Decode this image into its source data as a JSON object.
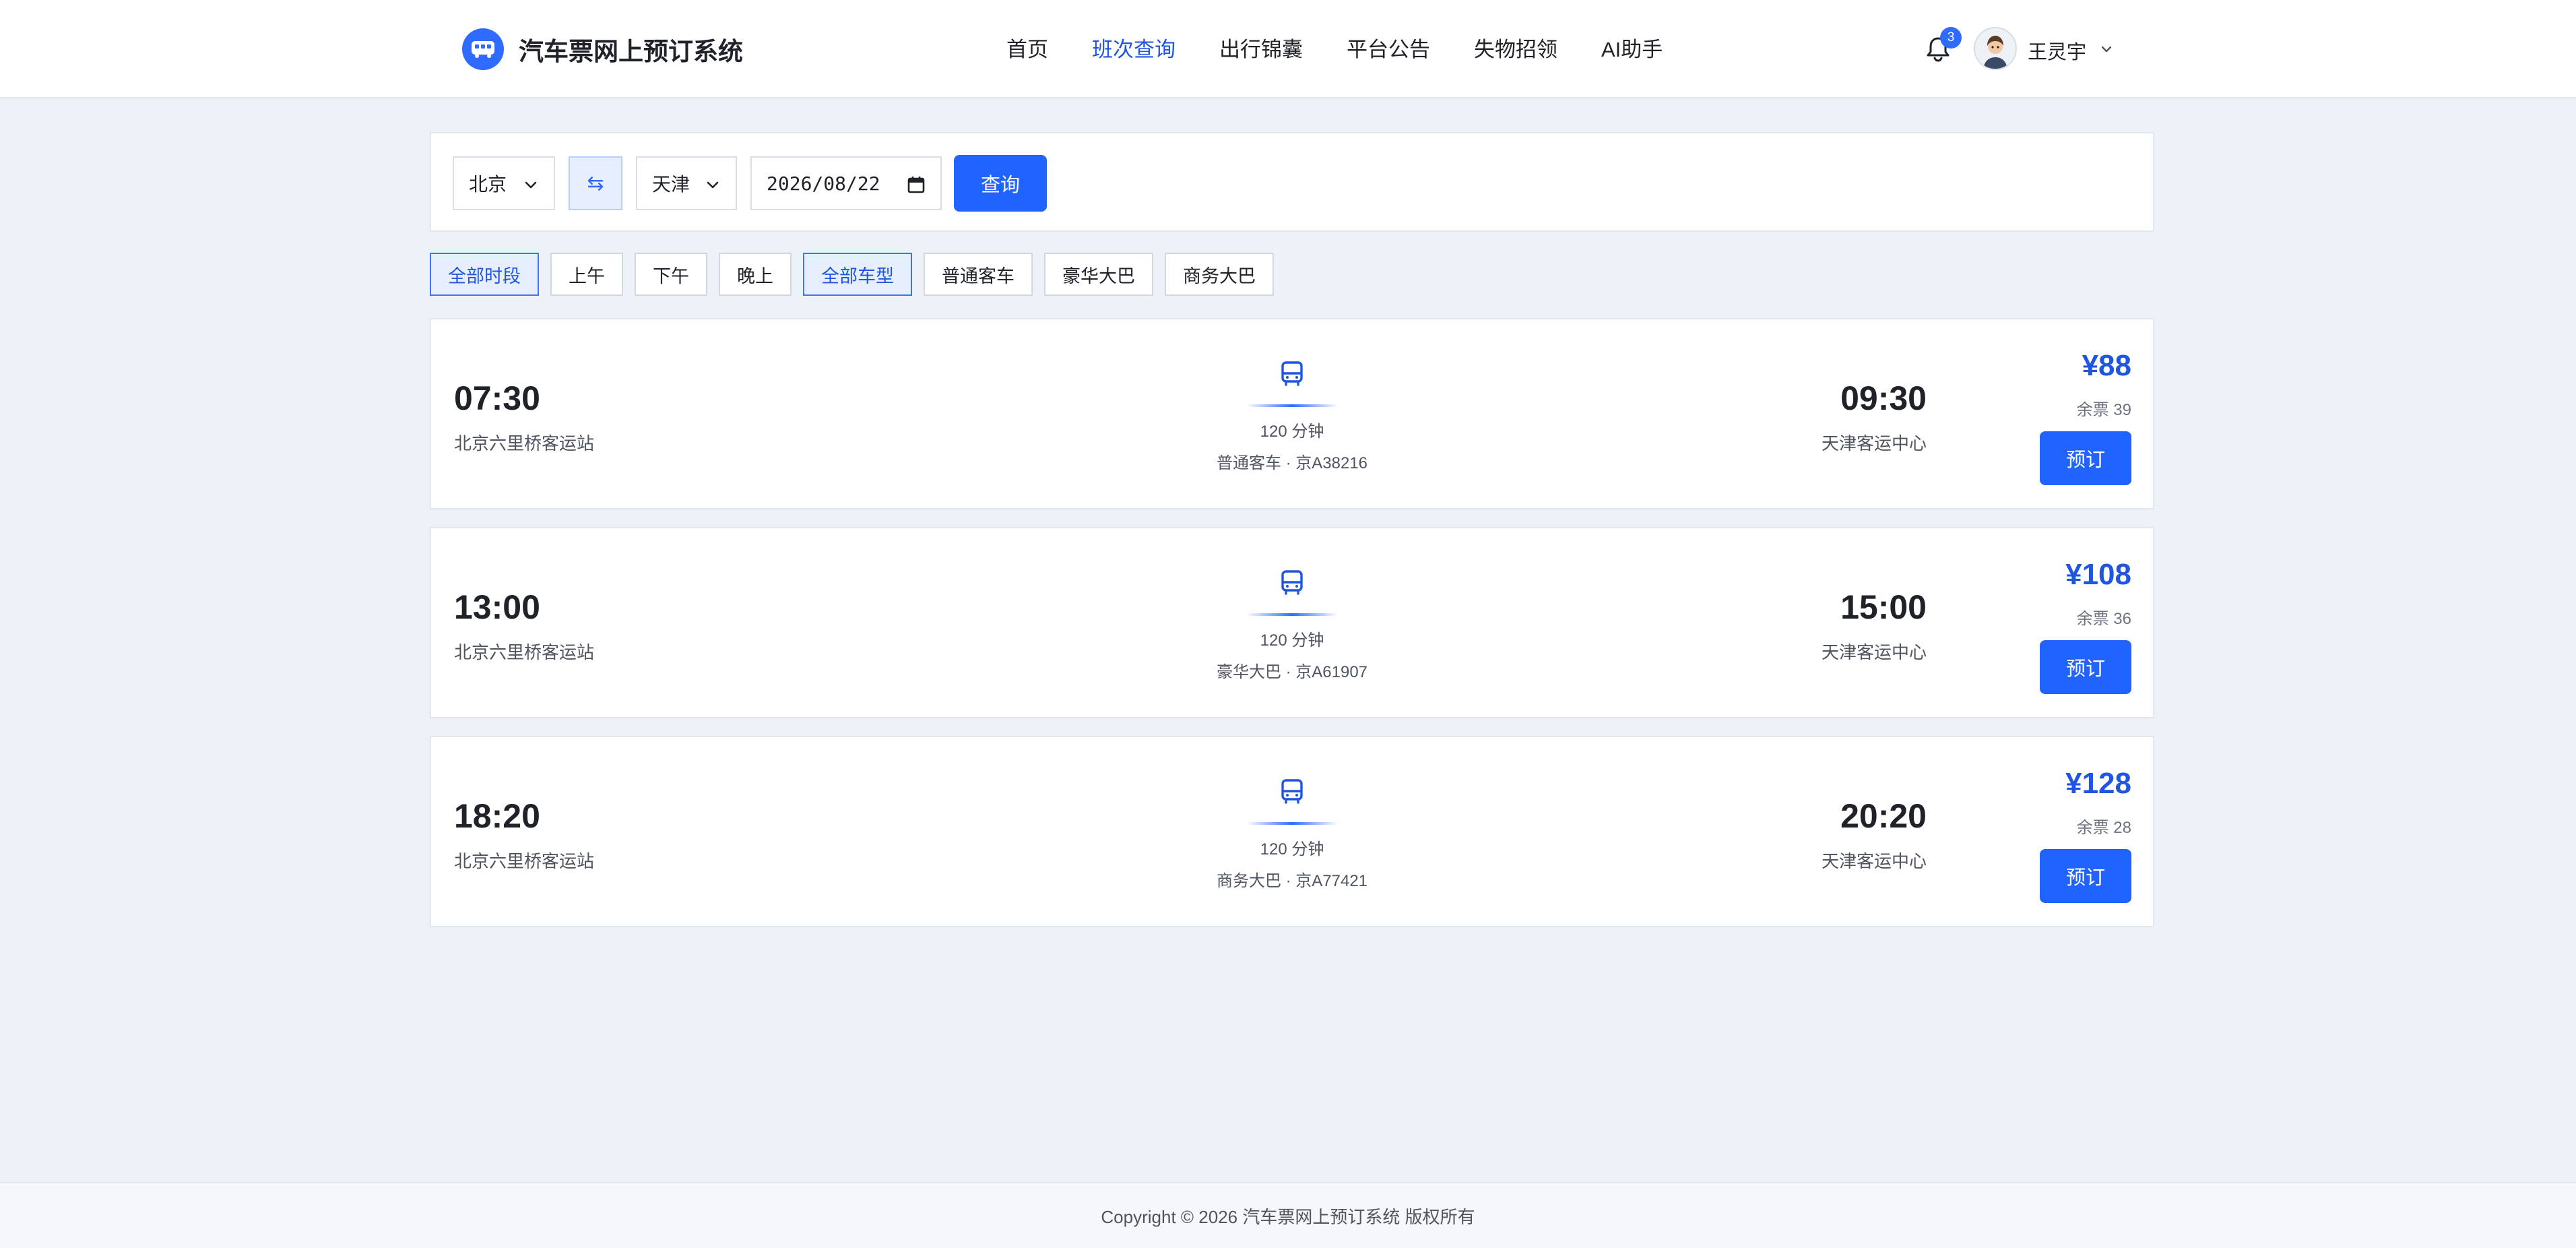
{
  "header": {
    "app_title": "汽车票网上预订系统",
    "nav": [
      "首页",
      "班次查询",
      "出行锦囊",
      "平台公告",
      "失物招领",
      "AI助手"
    ],
    "active_nav": "班次查询",
    "notification_count": "3",
    "user_name": "王灵宇"
  },
  "search": {
    "from": "北京",
    "swap_symbol": "⇆",
    "to": "天津",
    "date": "2026/08/22",
    "query_label": "查询"
  },
  "filters": {
    "time": [
      "全部时段",
      "上午",
      "下午",
      "晚上"
    ],
    "bus_type": [
      "全部车型",
      "普通客车",
      "豪华大巴",
      "商务大巴"
    ],
    "active": [
      "全部时段",
      "全部车型"
    ]
  },
  "trips": [
    {
      "dep_time": "07:30",
      "dep_station": "北京六里桥客运站",
      "duration": "120 分钟",
      "bus_info": "普通客车 · 京A38216",
      "arr_time": "09:30",
      "arr_station": "天津客运中心",
      "price": "¥88",
      "remaining": "余票 39",
      "book_label": "预订"
    },
    {
      "dep_time": "13:00",
      "dep_station": "北京六里桥客运站",
      "duration": "120 分钟",
      "bus_info": "豪华大巴 · 京A61907",
      "arr_time": "15:00",
      "arr_station": "天津客运中心",
      "price": "¥108",
      "remaining": "余票 36",
      "book_label": "预订"
    },
    {
      "dep_time": "18:20",
      "dep_station": "北京六里桥客运站",
      "duration": "120 分钟",
      "bus_info": "商务大巴 · 京A77421",
      "arr_time": "20:20",
      "arr_station": "天津客运中心",
      "price": "¥128",
      "remaining": "余票 28",
      "book_label": "预订"
    }
  ],
  "footer": {
    "copyright": "Copyright © 2026 汽车票网上预订系统 版权所有"
  },
  "icons": {
    "logo": "bus-icon",
    "notification": "bell-icon",
    "user_menu": "chevron-down-icon",
    "select": "chevron-down-icon",
    "date": "calendar-icon",
    "trip": "bus-icon"
  },
  "colors": {
    "accent": "#2163ff",
    "accent_text": "#1f55e0",
    "page_bg": "#edf1f8"
  }
}
